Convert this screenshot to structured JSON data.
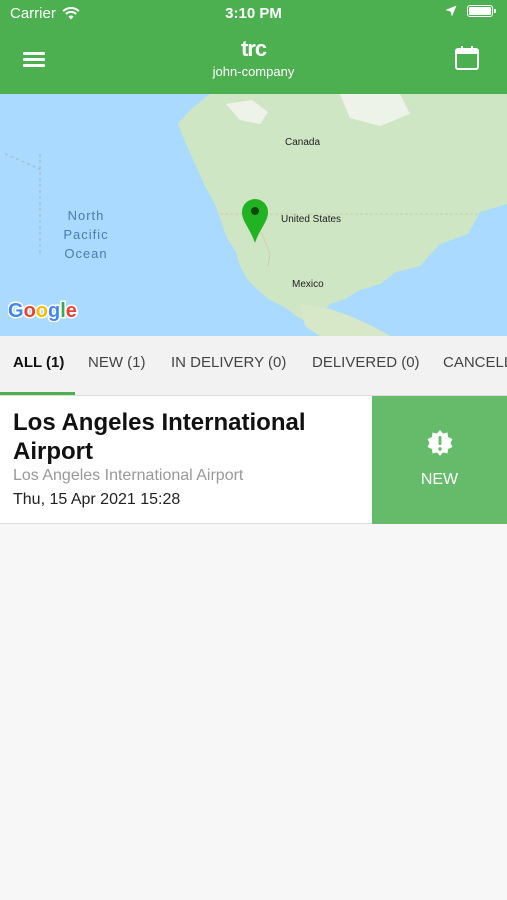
{
  "status_bar": {
    "carrier": "Carrier",
    "time": "3:10 PM"
  },
  "header": {
    "logo": "trc",
    "company": "john-company",
    "menu_icon": "hamburger-menu-icon",
    "calendar_icon": "calendar-icon",
    "background": "#4caf50"
  },
  "map": {
    "labels": {
      "canada": "Canada",
      "united_states": "United States",
      "mexico": "Mexico",
      "ocean_line1": "North",
      "ocean_line2": "Pacific",
      "ocean_line3": "Ocean"
    },
    "attribution": "Google",
    "pin_color": "#22b322"
  },
  "tabs": [
    {
      "label": "ALL (1)",
      "active": true
    },
    {
      "label": "NEW (1)",
      "active": false
    },
    {
      "label": "IN DELIVERY (0)",
      "active": false
    },
    {
      "label": "DELIVERED (0)",
      "active": false
    },
    {
      "label": "CANCELL",
      "active": false
    }
  ],
  "orders": [
    {
      "title": "Los Angeles International Airport",
      "subtitle": "Los Angeles International Airport",
      "date": "Thu, 15 Apr 2021 15:28",
      "status": "NEW",
      "status_icon": "alert-badge-icon",
      "status_color": "#66bb6a"
    }
  ]
}
